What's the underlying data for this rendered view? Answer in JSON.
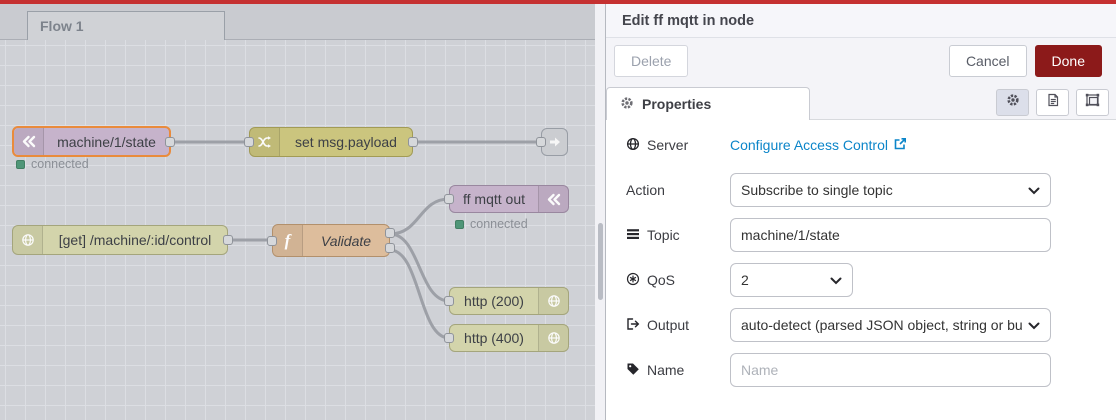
{
  "editor": {
    "tab_label": "Flow 1",
    "nodes": {
      "mqtt_in": {
        "label": "machine/1/state",
        "status": "connected"
      },
      "change": {
        "label": "set msg.payload"
      },
      "http_in": {
        "label": "[get] /machine/:id/control"
      },
      "function": {
        "label": "Validate"
      },
      "mqtt_out": {
        "label": "ff mqtt out",
        "status": "connected"
      },
      "http_200": {
        "label": "http (200)"
      },
      "http_400": {
        "label": "http (400)"
      }
    }
  },
  "panel": {
    "title": "Edit ff mqtt in node",
    "delete_label": "Delete",
    "cancel_label": "Cancel",
    "done_label": "Done",
    "properties_tab_label": "Properties",
    "fields": {
      "server_label": "Server",
      "server_link": "Configure Access Control",
      "action_label": "Action",
      "action_value": "Subscribe to single topic",
      "topic_label": "Topic",
      "topic_value": "machine/1/state",
      "qos_label": "QoS",
      "qos_value": "2",
      "output_label": "Output",
      "output_value": "auto-detect (parsed JSON object, string or buffer)",
      "name_label": "Name",
      "name_placeholder": "Name"
    }
  },
  "colors": {
    "accent_red": "#c53131",
    "done_button": "#8c1a1a",
    "link_blue": "#0b85c9",
    "status_green": "#4f9678",
    "selection_orange": "#e98b3c",
    "node_mqtt": "#c6b3cb",
    "node_change": "#cbc57e",
    "node_http": "#d3d4ab",
    "node_function": "#ddbd9c",
    "node_link": "#cbcdd1",
    "canvas_bg": "#cfd1d6"
  }
}
